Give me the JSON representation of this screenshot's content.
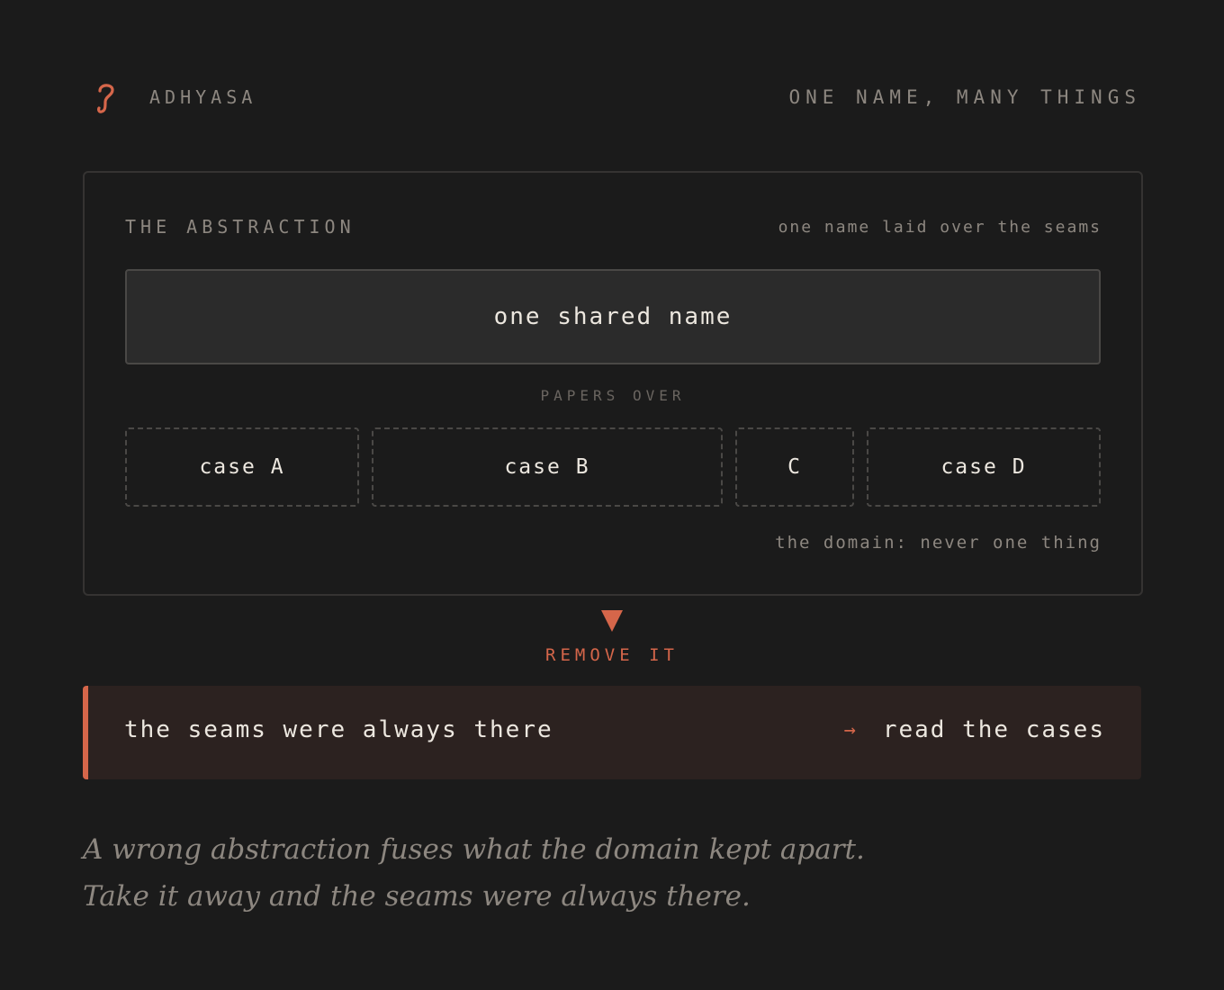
{
  "header": {
    "brand_icon": "hook-glyph-icon",
    "brand_name": "ADHYASA",
    "tagline": "ONE NAME, MANY THINGS"
  },
  "panel": {
    "title": "THE ABSTRACTION",
    "note": "one name laid over the seams",
    "shared_name": "one shared name",
    "papers_over": "PAPERS OVER",
    "cases": [
      {
        "label": "case A"
      },
      {
        "label": "case B"
      },
      {
        "label": "C"
      },
      {
        "label": "case D"
      }
    ],
    "domain_note": "the domain: never one thing"
  },
  "transition": {
    "icon": "triangle-down-icon",
    "label": "REMOVE IT"
  },
  "result": {
    "text": "the seams were always there",
    "arrow": "→",
    "action": "read the cases"
  },
  "caption": "A wrong abstraction fuses what the domain kept apart. Take it away and the seams were always there.",
  "colors": {
    "background": "#1b1b1b",
    "accent": "#d5664a",
    "muted_text": "#8d8780",
    "result_bg": "#2c2220"
  }
}
